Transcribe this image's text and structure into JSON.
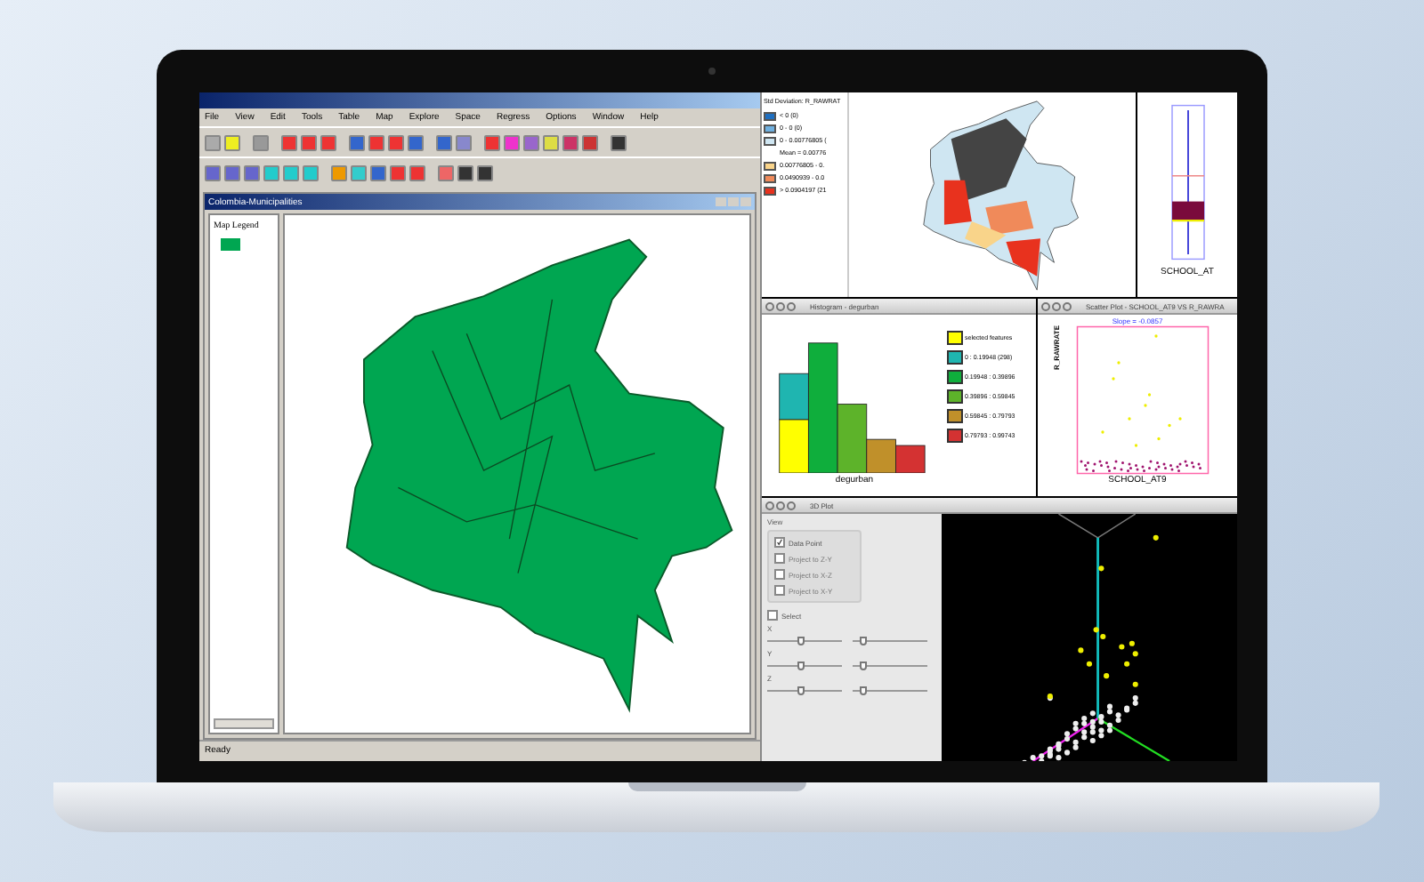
{
  "app": {
    "menu": [
      "File",
      "View",
      "Edit",
      "Tools",
      "Table",
      "Map",
      "Explore",
      "Space",
      "Regress",
      "Options",
      "Window",
      "Help"
    ],
    "status_bar": "Ready"
  },
  "map_window": {
    "title": "Colombia-Municipalities",
    "legend_title": "Map Legend",
    "legend": [
      {
        "color": "#00a651"
      }
    ]
  },
  "std_map": {
    "legend_title": "Std Deviation: R_RAWRAT",
    "items": [
      {
        "kind": "swatch",
        "label": "< 0 (0)",
        "color": "#1f6fc0"
      },
      {
        "kind": "swatch",
        "label": "0 - 0 (0)",
        "color": "#6fb0e0"
      },
      {
        "kind": "swatch",
        "label": "0 - 0.00776805 (",
        "color": "#cfe6f2"
      },
      {
        "kind": "text",
        "label": "Mean = 0.00776"
      },
      {
        "kind": "swatch",
        "label": "0.00776805 - 0.",
        "color": "#f9d48a"
      },
      {
        "kind": "swatch",
        "label": "0.0490939 - 0.0",
        "color": "#f08a5a"
      },
      {
        "kind": "swatch",
        "label": "> 0.0904197 (21",
        "color": "#e8321e"
      }
    ]
  },
  "box_plot": {
    "variable": "SCHOOL_AT"
  },
  "histogram": {
    "title": "Histogram - degurban",
    "xlabel": "degurban",
    "legend": [
      {
        "label": "selected features",
        "color": "#ffff00"
      },
      {
        "label": "0 : 0.19948 (298)",
        "color": "#1fb5b0"
      },
      {
        "label": "0.19948 : 0.39896",
        "color": "#0fae3c"
      },
      {
        "label": "0.39896 : 0.59845",
        "color": "#5db32a"
      },
      {
        "label": "0.59845 : 0.79793",
        "color": "#c0902a"
      },
      {
        "label": "0.79793 : 0.99743",
        "color": "#d43232"
      }
    ]
  },
  "scatter": {
    "title": "Scatter Plot - SCHOOL_AT9 VS R_RAWRA",
    "slope": "Slope = -0.0857",
    "xlabel": "SCHOOL_AT9",
    "ylabel": "R_RAWRATE"
  },
  "plot3d": {
    "title": "3D Plot",
    "group": "View",
    "options": [
      {
        "label": "Data Point",
        "checked": true
      },
      {
        "label": "Project to Z-Y",
        "checked": false
      },
      {
        "label": "Project to X-Z",
        "checked": false
      },
      {
        "label": "Project to X-Y",
        "checked": false
      }
    ],
    "select": {
      "label": "Select",
      "checked": false
    },
    "axes": [
      {
        "label": "X",
        "sliders": [
          {
            "level": 0.45
          },
          {
            "level": 0.15
          }
        ]
      },
      {
        "label": "Y",
        "sliders": [
          {
            "level": 0.45
          },
          {
            "level": 0.15
          }
        ]
      },
      {
        "label": "Z",
        "sliders": [
          {
            "level": 0.45
          },
          {
            "level": 0.15
          }
        ]
      }
    ]
  }
}
